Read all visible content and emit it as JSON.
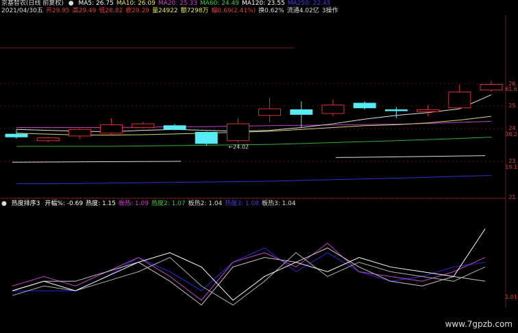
{
  "header": {
    "stock_title": "京基智农(日线 前复权)",
    "ma": [
      {
        "label": "MA5: 26.75",
        "color": "#ffffff"
      },
      {
        "label": "MA10: 26.09",
        "color": "#e8e84a"
      },
      {
        "label": "MA20: 25.33",
        "color": "#d040d0"
      },
      {
        "label": "MA60: 24.49",
        "color": "#3ccf3c"
      },
      {
        "label": "MA120: 23.55",
        "color": "#ffffff"
      },
      {
        "label": "MA250: 22.45",
        "color": "#4040e0"
      }
    ]
  },
  "info": [
    {
      "text": "2021/04/30五",
      "color": "#dddddd"
    },
    {
      "text": "开29.95",
      "color": "#e04040"
    },
    {
      "text": "高29.49",
      "color": "#e04040"
    },
    {
      "text": "低28.82",
      "color": "#e04040"
    },
    {
      "text": "收29.29",
      "color": "#e04040"
    },
    {
      "text": "量24922",
      "color": "#e8e84a"
    },
    {
      "text": "额7298万",
      "color": "#e8e84a"
    },
    {
      "text": "幅0.69(2.41%)",
      "color": "#e04040"
    },
    {
      "text": "换0.62%",
      "color": "#dddddd"
    },
    {
      "text": "流通4.02亿",
      "color": "#dddddd"
    },
    {
      "text": "3操作",
      "color": "#dddddd"
    }
  ],
  "indicator": {
    "name": "热度排序3",
    "items": [
      {
        "label": "开幅%: -0.69",
        "color": "#ffffff"
      },
      {
        "label": "热度: 1.15",
        "color": "#ffffff"
      },
      {
        "label": "板热: 1.09",
        "color": "#d040d0"
      },
      {
        "label": "热度2: 1.07",
        "color": "#3ccf3c"
      },
      {
        "label": "板热2: 1.04",
        "color": "#dddddd"
      },
      {
        "label": "热度3: 1.08",
        "color": "#4040e0"
      },
      {
        "label": "板热3: 1.04",
        "color": "#dddddd"
      }
    ]
  },
  "price_axis": [
    "26.",
    "61.6",
    "25.",
    "24.",
    "38.2",
    "23.",
    "19.1",
    "21.",
    "1.01"
  ],
  "annotation": "←24.02",
  "watermark": "www.7gpzb.com",
  "chart_data": {
    "type": "candlestick",
    "candles": [
      {
        "open": 24.65,
        "close": 24.5,
        "high": 24.9,
        "low": 24.4
      },
      {
        "open": 24.3,
        "close": 24.45,
        "high": 24.5,
        "low": 24.2
      },
      {
        "open": 24.55,
        "close": 24.9,
        "high": 24.95,
        "low": 24.4
      },
      {
        "open": 24.7,
        "close": 25.15,
        "high": 25.5,
        "low": 24.6
      },
      {
        "open": 25.0,
        "close": 25.2,
        "high": 25.3,
        "low": 24.95
      },
      {
        "open": 25.1,
        "close": 24.9,
        "high": 25.2,
        "low": 24.85
      },
      {
        "open": 24.75,
        "close": 24.15,
        "high": 24.8,
        "low": 24.02
      },
      {
        "open": 24.3,
        "close": 25.2,
        "high": 25.5,
        "low": 24.2
      },
      {
        "open": 25.65,
        "close": 26.0,
        "high": 26.6,
        "low": 25.3
      },
      {
        "open": 25.95,
        "close": 25.7,
        "high": 26.4,
        "low": 25.0
      },
      {
        "open": 25.75,
        "close": 26.2,
        "high": 26.5,
        "low": 25.6
      },
      {
        "open": 26.3,
        "close": 26.05,
        "high": 26.4,
        "low": 25.95
      },
      {
        "open": 25.95,
        "close": 25.9,
        "high": 26.1,
        "low": 25.5
      },
      {
        "open": 25.85,
        "close": 25.95,
        "high": 26.2,
        "low": 25.6
      },
      {
        "open": 26.05,
        "close": 26.9,
        "high": 27.3,
        "low": 26.0
      },
      {
        "open": 27.0,
        "close": 27.3,
        "high": 27.5,
        "low": 26.9
      }
    ],
    "ma5": [
      24.9,
      24.85,
      24.8,
      24.78,
      24.85,
      24.9,
      24.85,
      24.8,
      24.85,
      25.0,
      25.2,
      25.45,
      25.65,
      25.8,
      26.0,
      26.75
    ],
    "ma10": [
      24.7,
      24.65,
      24.6,
      24.6,
      24.62,
      24.66,
      24.7,
      24.75,
      24.8,
      24.9,
      25.0,
      25.1,
      25.15,
      25.25,
      25.4,
      25.6
    ],
    "ma20": [
      25.0,
      25.0,
      25.0,
      25.0,
      25.02,
      25.04,
      25.05,
      25.08,
      25.1,
      25.12,
      25.14,
      25.16,
      25.18,
      25.22,
      25.28,
      25.33
    ],
    "ma60": [
      24.0,
      24.0,
      24.0,
      24.0,
      24.02,
      24.04,
      24.06,
      24.08,
      24.1,
      24.15,
      24.2,
      24.25,
      24.3,
      24.36,
      24.42,
      24.49
    ],
    "ma120_segments": [
      [
        23.15,
        23.2
      ],
      [
        23.4,
        23.5
      ]
    ],
    "ma250": [
      22.0,
      22.0,
      22.02,
      22.04,
      22.06,
      22.08,
      22.1,
      22.12,
      22.14,
      22.18,
      22.22,
      22.26,
      22.3,
      22.35,
      22.4,
      22.45
    ],
    "heat": [
      1.02,
      1.04,
      1.02,
      1.05,
      1.08,
      1.1,
      1.07,
      1.0,
      1.05,
      1.08,
      1.06,
      1.09,
      1.07,
      1.06,
      1.05,
      1.15
    ],
    "board_heat": [
      1.03,
      1.05,
      1.03,
      1.06,
      1.09,
      1.05,
      1.0,
      1.08,
      1.1,
      1.07,
      1.12,
      1.06,
      1.05,
      1.04,
      1.06,
      1.09
    ],
    "heat2": [
      1.01,
      1.03,
      1.02,
      1.04,
      1.06,
      1.09,
      1.03,
      0.99,
      1.04,
      1.1,
      1.05,
      1.08,
      1.06,
      1.05,
      1.04,
      1.07
    ],
    "heat3": [
      1.02,
      1.02,
      1.02,
      1.05,
      1.09,
      1.06,
      1.02,
      1.08,
      1.11,
      1.06,
      1.1,
      1.06,
      1.04,
      1.05,
      1.07,
      1.08
    ],
    "board_heat3": [
      1.02,
      1.04,
      1.04,
      1.06,
      1.08,
      1.04,
      0.99,
      1.07,
      1.09,
      1.08,
      1.11,
      1.07,
      1.04,
      1.03,
      1.05,
      1.04
    ],
    "price_range": [
      21.3,
      27.5
    ],
    "ind_range": [
      0.97,
      1.2
    ]
  }
}
